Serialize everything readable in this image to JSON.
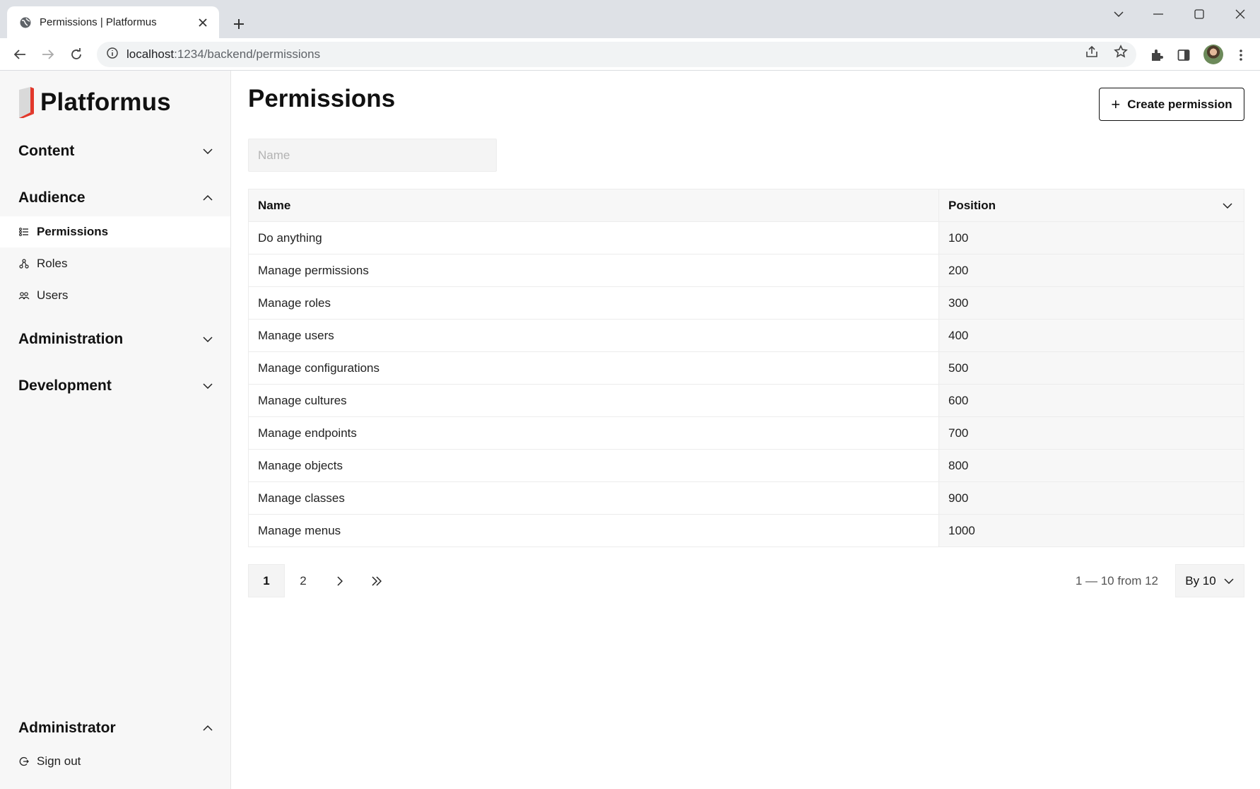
{
  "browser": {
    "tab_title": "Permissions | Platformus",
    "url_host": "localhost",
    "url_path": ":1234/backend/permissions"
  },
  "app": {
    "brand": "Platformus",
    "accent_color": "#e2382b"
  },
  "sidebar": {
    "sections": {
      "content": "Content",
      "audience": "Audience",
      "administration": "Administration",
      "development": "Development",
      "administrator": "Administrator"
    },
    "audience_items": [
      {
        "label": "Permissions",
        "icon": "list-icon",
        "active": true
      },
      {
        "label": "Roles",
        "icon": "roles-icon",
        "active": false
      },
      {
        "label": "Users",
        "icon": "users-icon",
        "active": false
      }
    ],
    "administrator_items": [
      {
        "label": "Sign out",
        "icon": "sign-out-icon"
      }
    ]
  },
  "main": {
    "title": "Permissions",
    "create_button_label": "Create permission",
    "filter_placeholder": "Name",
    "table": {
      "columns": [
        "Name",
        "Position"
      ],
      "rows": [
        [
          "Do anything",
          "100"
        ],
        [
          "Manage permissions",
          "200"
        ],
        [
          "Manage roles",
          "300"
        ],
        [
          "Manage users",
          "400"
        ],
        [
          "Manage configurations",
          "500"
        ],
        [
          "Manage cultures",
          "600"
        ],
        [
          "Manage endpoints",
          "700"
        ],
        [
          "Manage objects",
          "800"
        ],
        [
          "Manage classes",
          "900"
        ],
        [
          "Manage menus",
          "1000"
        ]
      ]
    },
    "pagination": {
      "pages": [
        "1",
        "2"
      ],
      "current_page": "1",
      "range_text": "1 — 10 from 12",
      "per_page_label": "By 10"
    }
  }
}
